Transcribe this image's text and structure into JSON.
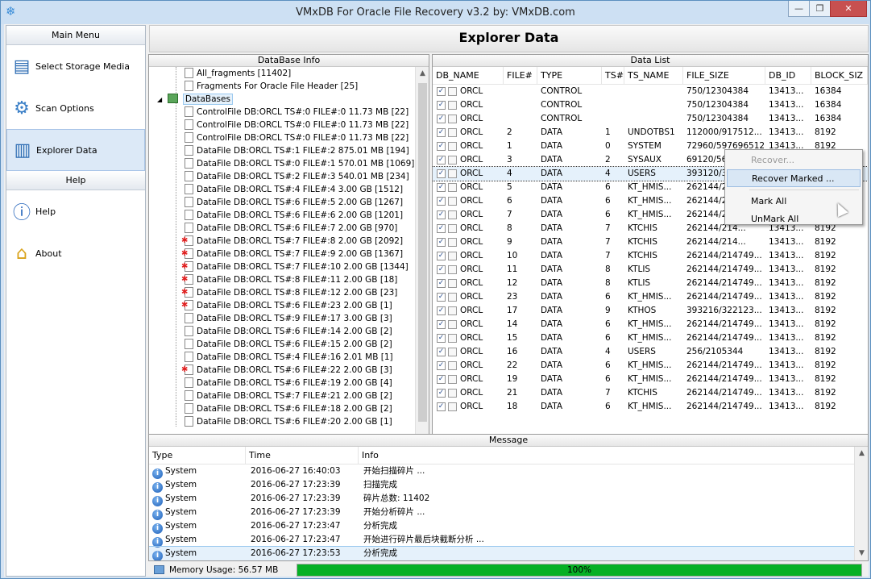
{
  "window": {
    "title": "VMxDB For Oracle File Recovery v3.2 by: VMxDB.com",
    "minimize": "—",
    "maximize": "❐",
    "close": "✕"
  },
  "nav": {
    "main_menu": "Main Menu",
    "help_header": "Help",
    "items": [
      {
        "label": "Select Storage Media",
        "icon": "storage-icon"
      },
      {
        "label": "Scan Options",
        "icon": "gear-icon"
      },
      {
        "label": "Explorer Data",
        "icon": "explorer-icon",
        "selected": true
      }
    ],
    "help_items": [
      {
        "label": "Help",
        "icon": "info-icon"
      },
      {
        "label": "About",
        "icon": "home-icon"
      }
    ]
  },
  "header": {
    "title": "Explorer Data"
  },
  "db_info": {
    "title": "DataBase Info",
    "top_items": [
      "All_fragments [11402]",
      "Fragments For Oracle File Header [25]"
    ],
    "databases_label": "DataBases",
    "files": [
      {
        "label": "ControlFile DB:ORCL TS#:0 FILE#:0 11.73 MB [22]",
        "bad": false
      },
      {
        "label": "ControlFile DB:ORCL TS#:0 FILE#:0 11.73 MB [22]",
        "bad": false
      },
      {
        "label": "ControlFile DB:ORCL TS#:0 FILE#:0 11.73 MB [22]",
        "bad": false
      },
      {
        "label": "DataFile DB:ORCL TS#:1 FILE#:2 875.01 MB [194]",
        "bad": false
      },
      {
        "label": "DataFile DB:ORCL TS#:0 FILE#:1 570.01 MB [1069]",
        "bad": false
      },
      {
        "label": "DataFile DB:ORCL TS#:2 FILE#:3 540.01 MB [234]",
        "bad": false
      },
      {
        "label": "DataFile DB:ORCL TS#:4 FILE#:4 3.00 GB [1512]",
        "bad": false
      },
      {
        "label": "DataFile DB:ORCL TS#:6 FILE#:5 2.00 GB [1267]",
        "bad": false
      },
      {
        "label": "DataFile DB:ORCL TS#:6 FILE#:6 2.00 GB [1201]",
        "bad": false
      },
      {
        "label": "DataFile DB:ORCL TS#:6 FILE#:7 2.00 GB [970]",
        "bad": false
      },
      {
        "label": "DataFile DB:ORCL TS#:7 FILE#:8 2.00 GB [2092]",
        "bad": true
      },
      {
        "label": "DataFile DB:ORCL TS#:7 FILE#:9 2.00 GB [1367]",
        "bad": true
      },
      {
        "label": "DataFile DB:ORCL TS#:7 FILE#:10 2.00 GB [1344]",
        "bad": true
      },
      {
        "label": "DataFile DB:ORCL TS#:8 FILE#:11 2.00 GB [18]",
        "bad": true
      },
      {
        "label": "DataFile DB:ORCL TS#:8 FILE#:12 2.00 GB [23]",
        "bad": true
      },
      {
        "label": "DataFile DB:ORCL TS#:6 FILE#:23 2.00 GB [1]",
        "bad": true
      },
      {
        "label": "DataFile DB:ORCL TS#:9 FILE#:17 3.00 GB [3]",
        "bad": false
      },
      {
        "label": "DataFile DB:ORCL TS#:6 FILE#:14 2.00 GB [2]",
        "bad": false
      },
      {
        "label": "DataFile DB:ORCL TS#:6 FILE#:15 2.00 GB [2]",
        "bad": false
      },
      {
        "label": "DataFile DB:ORCL TS#:4 FILE#:16 2.01 MB [1]",
        "bad": false
      },
      {
        "label": "DataFile DB:ORCL TS#:6 FILE#:22 2.00 GB [3]",
        "bad": true
      },
      {
        "label": "DataFile DB:ORCL TS#:6 FILE#:19 2.00 GB [4]",
        "bad": false
      },
      {
        "label": "DataFile DB:ORCL TS#:7 FILE#:21 2.00 GB [2]",
        "bad": false
      },
      {
        "label": "DataFile DB:ORCL TS#:6 FILE#:18 2.00 GB [2]",
        "bad": false
      },
      {
        "label": "DataFile DB:ORCL TS#:6 FILE#:20 2.00 GB [1]",
        "bad": false
      }
    ]
  },
  "data_list": {
    "title": "Data List",
    "columns": [
      "DB_NAME",
      "FILE#",
      "TYPE",
      "TS#",
      "TS_NAME",
      "FILE_SIZE",
      "DB_ID",
      "BLOCK_SIZ"
    ],
    "rows": [
      [
        "ORCL",
        "",
        "CONTROL",
        "",
        "",
        "750/12304384",
        "13413...",
        "16384"
      ],
      [
        "ORCL",
        "",
        "CONTROL",
        "",
        "",
        "750/12304384",
        "13413...",
        "16384"
      ],
      [
        "ORCL",
        "",
        "CONTROL",
        "",
        "",
        "750/12304384",
        "13413...",
        "16384"
      ],
      [
        "ORCL",
        "2",
        "DATA",
        "1",
        "UNDOTBS1",
        "112000/917512...",
        "13413...",
        "8192"
      ],
      [
        "ORCL",
        "1",
        "DATA",
        "0",
        "SYSTEM",
        "72960/597696512",
        "13413...",
        "8192"
      ],
      [
        "ORCL",
        "3",
        "DATA",
        "2",
        "SYSAUX",
        "69120/566239232",
        "13413...",
        "8192"
      ],
      [
        "ORCL",
        "4",
        "DATA",
        "4",
        "USERS",
        "393120/32...",
        "13413...",
        "8192"
      ],
      [
        "ORCL",
        "5",
        "DATA",
        "6",
        "KT_HMIS...",
        "262144/214...",
        "13413...",
        "8192"
      ],
      [
        "ORCL",
        "6",
        "DATA",
        "6",
        "KT_HMIS...",
        "262144/214...",
        "13413...",
        "8192"
      ],
      [
        "ORCL",
        "7",
        "DATA",
        "6",
        "KT_HMIS...",
        "262144/214...",
        "13413...",
        "8192"
      ],
      [
        "ORCL",
        "8",
        "DATA",
        "7",
        "KTCHIS",
        "262144/214...",
        "13413...",
        "8192"
      ],
      [
        "ORCL",
        "9",
        "DATA",
        "7",
        "KTCHIS",
        "262144/214...",
        "13413...",
        "8192"
      ],
      [
        "ORCL",
        "10",
        "DATA",
        "7",
        "KTCHIS",
        "262144/214749...",
        "13413...",
        "8192"
      ],
      [
        "ORCL",
        "11",
        "DATA",
        "8",
        "KTLIS",
        "262144/214749...",
        "13413...",
        "8192"
      ],
      [
        "ORCL",
        "12",
        "DATA",
        "8",
        "KTLIS",
        "262144/214749...",
        "13413...",
        "8192"
      ],
      [
        "ORCL",
        "23",
        "DATA",
        "6",
        "KT_HMIS...",
        "262144/214749...",
        "13413...",
        "8192"
      ],
      [
        "ORCL",
        "17",
        "DATA",
        "9",
        "KTHOS",
        "393216/322123...",
        "13413...",
        "8192"
      ],
      [
        "ORCL",
        "14",
        "DATA",
        "6",
        "KT_HMIS...",
        "262144/214749...",
        "13413...",
        "8192"
      ],
      [
        "ORCL",
        "15",
        "DATA",
        "6",
        "KT_HMIS...",
        "262144/214749...",
        "13413...",
        "8192"
      ],
      [
        "ORCL",
        "16",
        "DATA",
        "4",
        "USERS",
        "256/2105344",
        "13413...",
        "8192"
      ],
      [
        "ORCL",
        "22",
        "DATA",
        "6",
        "KT_HMIS...",
        "262144/214749...",
        "13413...",
        "8192"
      ],
      [
        "ORCL",
        "19",
        "DATA",
        "6",
        "KT_HMIS...",
        "262144/214749...",
        "13413...",
        "8192"
      ],
      [
        "ORCL",
        "21",
        "DATA",
        "7",
        "KTCHIS",
        "262144/214749...",
        "13413...",
        "8192"
      ],
      [
        "ORCL",
        "18",
        "DATA",
        "6",
        "KT_HMIS...",
        "262144/214749...",
        "13413...",
        "8192"
      ]
    ],
    "selected_row": 6
  },
  "context_menu": {
    "recover": "Recover...",
    "recover_marked": "Recover Marked ...",
    "mark_all": "Mark All",
    "unmark_all": "UnMark All"
  },
  "message": {
    "title": "Message",
    "columns": [
      "Type",
      "Time",
      "Info"
    ],
    "rows": [
      [
        "System",
        "2016-06-27 16:40:03",
        "开始扫描碎片 ..."
      ],
      [
        "System",
        "2016-06-27 17:23:39",
        "扫描完成"
      ],
      [
        "System",
        "2016-06-27 17:23:39",
        "碎片总数: 11402"
      ],
      [
        "System",
        "2016-06-27 17:23:39",
        "开始分析碎片 ..."
      ],
      [
        "System",
        "2016-06-27 17:23:47",
        "分析完成"
      ],
      [
        "System",
        "2016-06-27 17:23:47",
        "开始进行碎片最后块截断分析 ..."
      ],
      [
        "System",
        "2016-06-27 17:23:53",
        "分析完成"
      ]
    ]
  },
  "status": {
    "memory": "Memory Usage: 56.57 MB",
    "progress_text": "100%",
    "progress": 100,
    "progress_color": "#06b025"
  }
}
